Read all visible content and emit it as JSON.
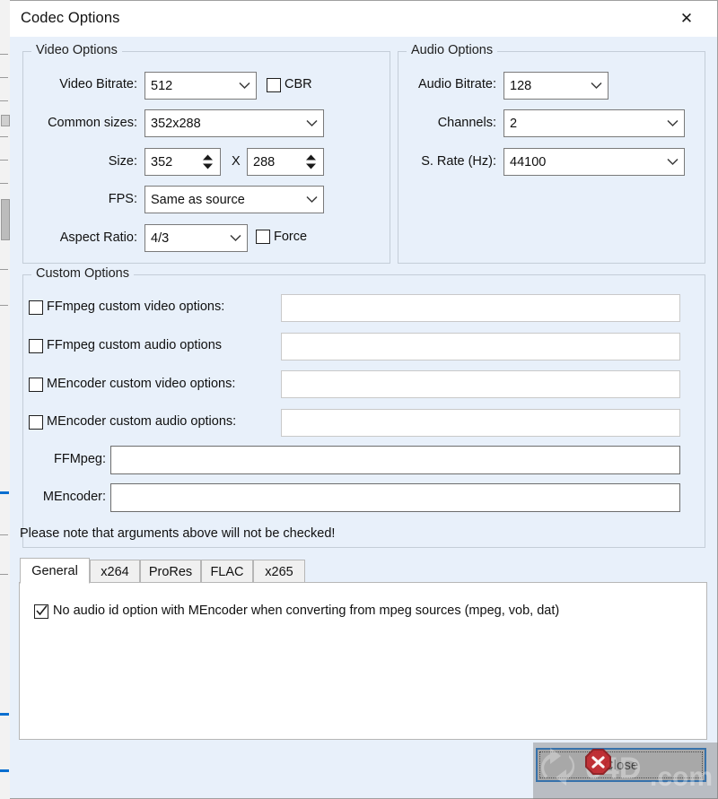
{
  "window": {
    "title": "Codec Options",
    "close_icon": "close-x-icon"
  },
  "video_group": {
    "title": "Video Options",
    "bitrate_label": "Video Bitrate:",
    "bitrate_value": "512",
    "cbr_label": "CBR",
    "cbr_checked": false,
    "common_sizes_label": "Common sizes:",
    "common_sizes_value": "352x288",
    "size_label": "Size:",
    "size_width": "352",
    "size_separator": "X",
    "size_height": "288",
    "fps_label": "FPS:",
    "fps_value": "Same as source",
    "aspect_label": "Aspect Ratio:",
    "aspect_value": "4/3",
    "force_label": "Force",
    "force_checked": false
  },
  "audio_group": {
    "title": "Audio Options",
    "bitrate_label": "Audio Bitrate:",
    "bitrate_value": "128",
    "channels_label": "Channels:",
    "channels_value": "2",
    "srate_label": "S. Rate (Hz):",
    "srate_value": "44100"
  },
  "custom_group": {
    "title": "Custom Options",
    "rows": [
      {
        "label": "FFmpeg custom video options:",
        "checked": false,
        "value": ""
      },
      {
        "label": "FFmpeg custom audio options",
        "checked": false,
        "value": ""
      },
      {
        "label": "MEncoder custom video options:",
        "checked": false,
        "value": ""
      },
      {
        "label": "MEncoder custom audio options:",
        "checked": false,
        "value": ""
      }
    ],
    "ffmpeg_label": "FFMpeg:",
    "ffmpeg_value": "",
    "mencoder_label": "MEncoder:",
    "mencoder_value": ""
  },
  "note": "Please note that arguments above will not be checked!",
  "tabs": [
    {
      "label": "General",
      "active": true
    },
    {
      "label": "x264",
      "active": false
    },
    {
      "label": "ProRes",
      "active": false
    },
    {
      "label": "FLAC",
      "active": false
    },
    {
      "label": "x265",
      "active": false
    }
  ],
  "general_tab": {
    "option_label": "No audio id option with MEncoder when converting from mpeg sources (mpeg, vob, dat)",
    "option_checked": true
  },
  "footer": {
    "close_label": "Close",
    "close_icon": "stop-x-icon"
  },
  "watermark": {
    "text": "04D.com",
    "icon": "refresh-arrow-icon"
  },
  "colors": {
    "dialog_bg": "#e8f0fa",
    "titlebar_bg": "#ffffff",
    "focus_accent": "#0a6fd0",
    "field_bg": "#ffffff",
    "group_border": "#c4cdd8",
    "stop_red": "#c1272d"
  }
}
